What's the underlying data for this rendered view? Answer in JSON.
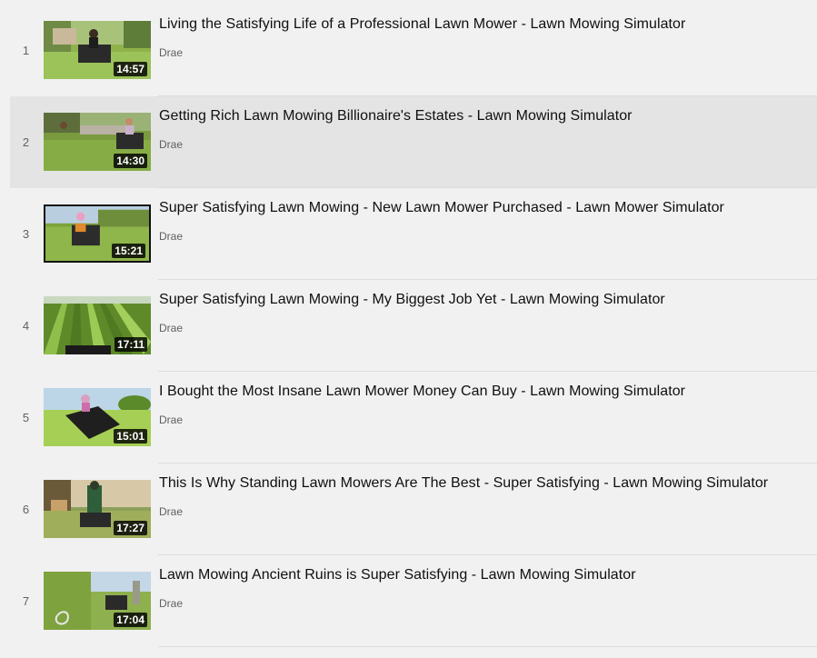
{
  "playlist": {
    "items": [
      {
        "index": "1",
        "title": "Living the Satisfying Life of a Professional Lawn Mower - Lawn Mowing Simulator",
        "channel": "Drae",
        "duration": "14:57"
      },
      {
        "index": "2",
        "title": "Getting Rich Lawn Mowing Billionaire's Estates - Lawn Mowing Simulator",
        "channel": "Drae",
        "duration": "14:30"
      },
      {
        "index": "3",
        "title": "Super Satisfying Lawn Mowing - New Lawn Mower Purchased - Lawn Mower Simulator",
        "channel": "Drae",
        "duration": "15:21"
      },
      {
        "index": "4",
        "title": "Super Satisfying Lawn Mowing - My Biggest Job Yet - Lawn Mowing Simulator",
        "channel": "Drae",
        "duration": "17:11"
      },
      {
        "index": "5",
        "title": "I Bought the Most Insane Lawn Mower Money Can Buy - Lawn Mowing Simulator",
        "channel": "Drae",
        "duration": "15:01"
      },
      {
        "index": "6",
        "title": "This Is Why Standing Lawn Mowers Are The Best - Super Satisfying - Lawn Mowing Simulator",
        "channel": "Drae",
        "duration": "17:27"
      },
      {
        "index": "7",
        "title": "Lawn Mowing Ancient Ruins is Super Satisfying - Lawn Mowing Simulator",
        "channel": "Drae",
        "duration": "17:04"
      }
    ]
  }
}
